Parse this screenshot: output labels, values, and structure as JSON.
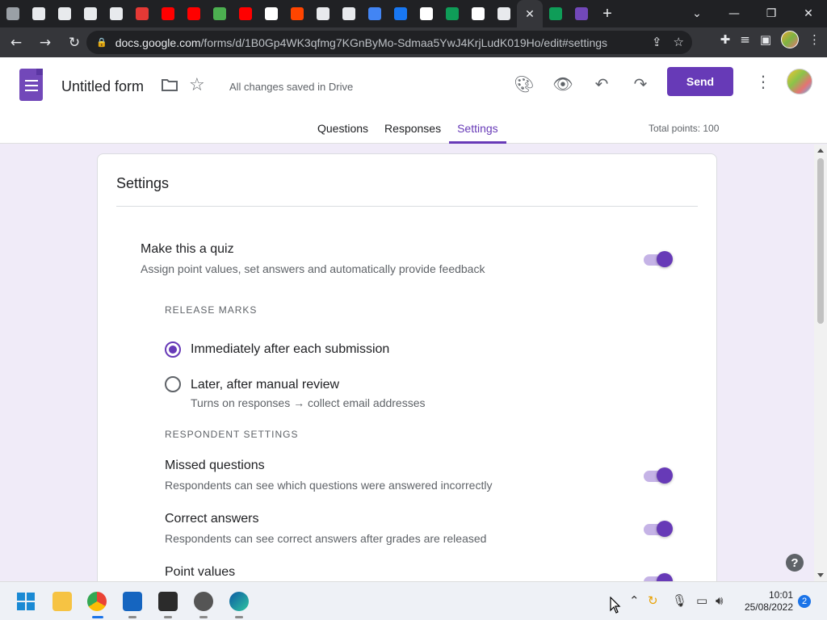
{
  "browser": {
    "tabs": [
      {
        "icon": "roblox-icon",
        "color": "#9aa0a6"
      },
      {
        "icon": "globe-icon",
        "color": "#e8eaed"
      },
      {
        "icon": "calendar-icon",
        "color": "#e8eaed"
      },
      {
        "icon": "chrome-icon",
        "color": "#e8eaed"
      },
      {
        "icon": "globe-icon",
        "color": "#e8eaed"
      },
      {
        "icon": "record-icon",
        "color": "#e53935"
      },
      {
        "icon": "youtube-icon",
        "color": "#ff0000"
      },
      {
        "icon": "youtube-icon",
        "color": "#ff0000"
      },
      {
        "icon": "bird-icon",
        "color": "#4caf50"
      },
      {
        "icon": "youtube-icon",
        "color": "#ff0000"
      },
      {
        "icon": "google-icon",
        "color": "#ffffff"
      },
      {
        "icon": "reddit-icon",
        "color": "#ff4500"
      },
      {
        "icon": "globe-icon",
        "color": "#e8eaed"
      },
      {
        "icon": "chrome-icon",
        "color": "#e8eaed"
      },
      {
        "icon": "docs-icon",
        "color": "#4285f4"
      },
      {
        "icon": "infinity-icon",
        "color": "#1877f2"
      },
      {
        "icon": "google-icon",
        "color": "#ffffff"
      },
      {
        "icon": "chat-icon",
        "color": "#0f9d58"
      },
      {
        "icon": "google-icon",
        "color": "#ffffff"
      },
      {
        "icon": "globe-icon",
        "color": "#e8eaed"
      }
    ],
    "active_tab_close": "✕",
    "after_tabs": [
      {
        "icon": "maps-icon",
        "color": "#0f9d58"
      },
      {
        "icon": "forms-icon",
        "color": "#7248b9"
      }
    ],
    "new_tab": "+",
    "url_host": "docs.google.com",
    "url_path": "/forms/d/1B0Gp4WK3qfmg7KGnByMo-Sdmaa5YwJ4KrjLudK019Ho/edit#settings"
  },
  "form": {
    "title": "Untitled form",
    "saved_status": "All changes saved in Drive",
    "send_label": "Send",
    "tabs": [
      "Questions",
      "Responses",
      "Settings"
    ],
    "active_tab": "Settings",
    "total_points": "Total points: 100"
  },
  "settings": {
    "heading": "Settings",
    "quiz_title": "Make this a quiz",
    "quiz_sub": "Assign point values, set answers and automatically provide feedback",
    "release_marks_label": "RELEASE MARKS",
    "release_immediate": "Immediately after each submission",
    "release_later": "Later, after manual review",
    "release_later_sub": "Turns on responses → collect email addresses",
    "respondent_label": "RESPONDENT SETTINGS",
    "missed_title": "Missed questions",
    "missed_sub": "Respondents can see which questions were answered incorrectly",
    "correct_title": "Correct answers",
    "correct_sub": "Respondents can see correct answers after grades are released",
    "points_title": "Point values"
  },
  "taskbar": {
    "time": "10:01",
    "date": "25/08/2022",
    "notifications": "2"
  },
  "colors": {
    "accent": "#673ab7",
    "background": "#f0ebf8"
  }
}
